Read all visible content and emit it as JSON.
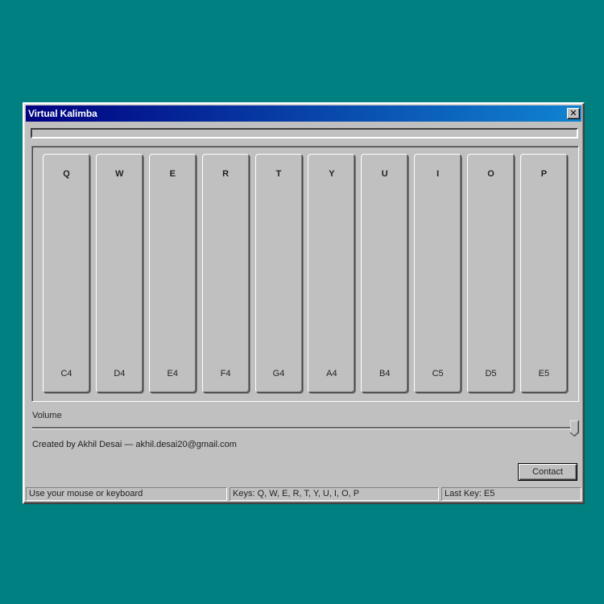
{
  "window": {
    "title": "Virtual Kalimba",
    "close_label": "✕"
  },
  "progress": {
    "fill_percent": 0
  },
  "keys": [
    {
      "letter": "Q",
      "note": "C4"
    },
    {
      "letter": "W",
      "note": "D4"
    },
    {
      "letter": "E",
      "note": "E4"
    },
    {
      "letter": "R",
      "note": "F4"
    },
    {
      "letter": "T",
      "note": "G4"
    },
    {
      "letter": "Y",
      "note": "A4"
    },
    {
      "letter": "U",
      "note": "B4"
    },
    {
      "letter": "I",
      "note": "C5"
    },
    {
      "letter": "O",
      "note": "D5"
    },
    {
      "letter": "P",
      "note": "E5"
    }
  ],
  "volume": {
    "label": "Volume",
    "level_percent": 100
  },
  "credits": "Created by Akhil Desai — akhil.desai20@gmail.com",
  "contact_label": "Contact",
  "statusbar": {
    "hint": "Use your mouse or keyboard",
    "keys": "Keys: Q, W, E, R, T, Y, U, I, O, P",
    "last_key": "Last Key: E5"
  },
  "colors": {
    "desktop": "#008080",
    "window": "#c0c0c0",
    "title_start": "#000080",
    "title_end": "#1084d0"
  }
}
